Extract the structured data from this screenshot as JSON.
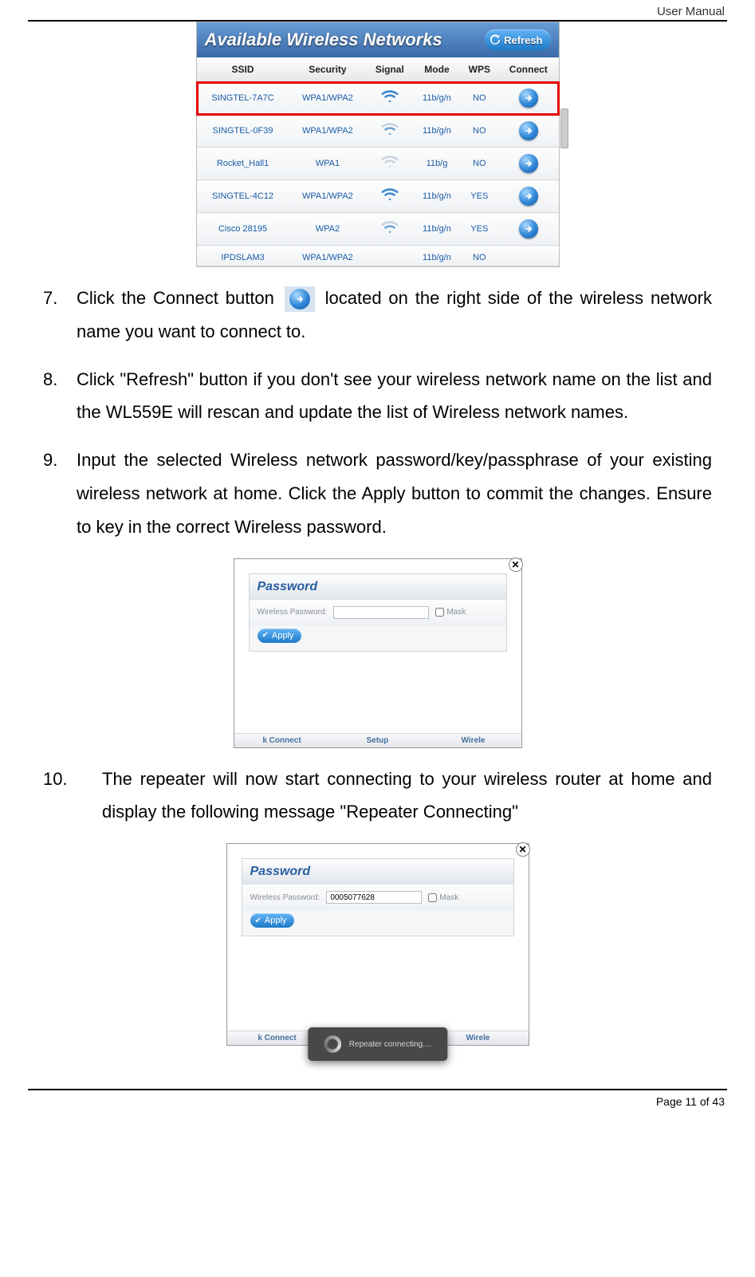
{
  "header": {
    "doc_title": "User Manual"
  },
  "footer": {
    "page_text": "Page 11 of 43"
  },
  "networks_panel": {
    "title": "Available Wireless Networks",
    "refresh_label": "Refresh",
    "columns": {
      "ssid": "SSID",
      "security": "Security",
      "signal": "Signal",
      "mode": "Mode",
      "wps": "WPS",
      "connect": "Connect"
    },
    "rows": [
      {
        "ssid": "SINGTEL-7A7C",
        "security": "WPA1/WPA2",
        "mode": "11b/g/n",
        "wps": "NO"
      },
      {
        "ssid": "SINGTEL-0F39",
        "security": "WPA1/WPA2",
        "mode": "11b/g/n",
        "wps": "NO"
      },
      {
        "ssid": "Rocket_Hall1",
        "security": "WPA1",
        "mode": "11b/g",
        "wps": "NO"
      },
      {
        "ssid": "SINGTEL-4C12",
        "security": "WPA1/WPA2",
        "mode": "11b/g/n",
        "wps": "YES"
      },
      {
        "ssid": "Cisco 28195",
        "security": "WPA2",
        "mode": "11b/g/n",
        "wps": "YES"
      },
      {
        "ssid": "IPDSLAM3",
        "security": "WPA1/WPA2",
        "mode": "11b/g/n",
        "wps": "NO"
      }
    ]
  },
  "steps": {
    "s7": {
      "num": "7.",
      "before": "Click the Connect button ",
      "after": " located on the right side of the wireless network name you want to connect to."
    },
    "s8": {
      "num": "8.",
      "text": "Click \"Refresh\" button if you don't see your wireless network name on the list and the WL559E will rescan and update the list of Wireless network names."
    },
    "s9": {
      "num": "9.",
      "text": "Input the selected Wireless network password/key/passphrase of your existing wireless network at home. Click the Apply button to commit the changes. Ensure to key in the correct Wireless password."
    },
    "s10": {
      "num": "10.",
      "text": "The repeater will now start connecting to your wireless router at home and display the following message \"Repeater Connecting\""
    }
  },
  "password_dialog": {
    "heading": "Password",
    "label": "Wireless Password:",
    "value1": "",
    "value2": "0005077628",
    "mask_label": "Mask",
    "apply_label": "Apply",
    "toast": "Repeater connecting....",
    "tabs": {
      "left": "k Connect",
      "mid": "Setup",
      "right": "Wirele"
    }
  }
}
